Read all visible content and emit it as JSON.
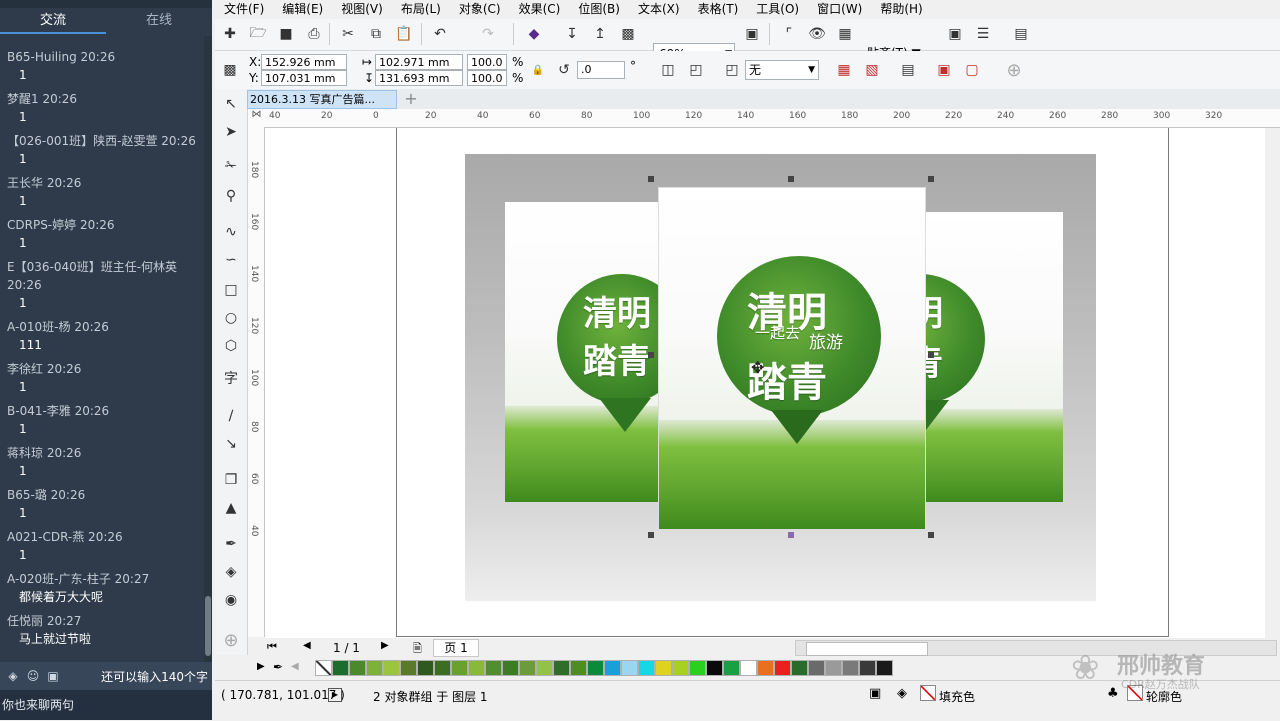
{
  "chat": {
    "tabs": [
      "交流",
      "在线"
    ],
    "messages": [
      {
        "who": "B65-Huiling 20:26",
        "text": "1"
      },
      {
        "who": "梦醒1 20:26",
        "text": "1"
      },
      {
        "who": "【026-001班】陕西-赵雯萱 20:26",
        "text": "1"
      },
      {
        "who": "王长华 20:26",
        "text": "1"
      },
      {
        "who": "CDRPS-婷婷 20:26",
        "text": "1"
      },
      {
        "who": "E【036-040班】班主任-何林英 20:26",
        "text": "1"
      },
      {
        "who": "A-010班-杨 20:26",
        "text": "111"
      },
      {
        "who": "李徐红 20:26",
        "text": "1"
      },
      {
        "who": "B-041-李雅 20:26",
        "text": "1"
      },
      {
        "who": "蒋科琼 20:26",
        "text": "1"
      },
      {
        "who": "B65-璐 20:26",
        "text": "1"
      },
      {
        "who": "A021-CDR-燕 20:26",
        "text": "1"
      },
      {
        "who": "A-020班-广东-柱子 20:27",
        "text": "都候着万大大呢"
      },
      {
        "who": "任悦丽 20:27",
        "text": "马上就过节啦"
      }
    ],
    "remaining": "还可以输入140个字",
    "input_text": "你也来聊两句"
  },
  "menu": [
    "文件(F)",
    "编辑(E)",
    "视图(V)",
    "布局(L)",
    "对象(C)",
    "效果(C)",
    "位图(B)",
    "文本(X)",
    "表格(T)",
    "工具(O)",
    "窗口(W)",
    "帮助(H)"
  ],
  "toolbar": {
    "zoom": "69%",
    "snap_label": "贴齐(T)"
  },
  "props": {
    "x_label": "X:",
    "y_label": "Y:",
    "x": "152.926 mm",
    "y": "107.031 mm",
    "w": "102.971 mm",
    "h": "131.693 mm",
    "scale_w": "100.0",
    "scale_h": "100.0",
    "percent": "%",
    "rotation": ".0",
    "degree": "°",
    "outline": "无"
  },
  "document": {
    "tab_title": "2016.3.13 写真广告篇..."
  },
  "ruler": {
    "h_ticks": [
      "40",
      "20",
      "0",
      "20",
      "40",
      "60",
      "80",
      "100",
      "120",
      "140",
      "160",
      "180",
      "200",
      "220",
      "240",
      "260",
      "280",
      "300",
      "320"
    ],
    "v_ticks": [
      "180",
      "160",
      "140",
      "120",
      "100",
      "80",
      "60",
      "40"
    ]
  },
  "poster": {
    "title_line1": "清明",
    "title_line2": "踏青",
    "subtitle1": "一起去",
    "subtitle2": "旅游"
  },
  "pager": {
    "page_of": "1 / 1",
    "page_tab": "页 1"
  },
  "palette": [
    "#ffffff",
    "#1e6b2e",
    "#4a8a2a",
    "#7cb23a",
    "#9cc43c",
    "#5a7a2a",
    "#2f5a1f",
    "#3b6e22",
    "#6aa02c",
    "#8ab83a",
    "#4f8f2f",
    "#3d7b24",
    "#6c9c3a",
    "#93c24a",
    "#2e6e2a",
    "#4e8e1e",
    "#0a8a3a",
    "#1aa0d8",
    "#9ad6f0",
    "#16d6e8",
    "#e0d020",
    "#a8d020",
    "#2ad020",
    "#0a0a0a",
    "#1aa040",
    "#ffffff",
    "#e87020",
    "#e82020",
    "#2a6a2a",
    "#6a6a6a",
    "#9a9a9a",
    "#7a7a7a",
    "#3a3a3a",
    "#1a1a1a"
  ],
  "status": {
    "coords": "( 170.781, 101.017 )",
    "selection": "2 对象群组 于 图层 1",
    "fill_label": "填充色",
    "outline_label": "轮廓色"
  },
  "watermark": {
    "name": "邢帅教育",
    "sub": "CDR赵万杰战队"
  }
}
